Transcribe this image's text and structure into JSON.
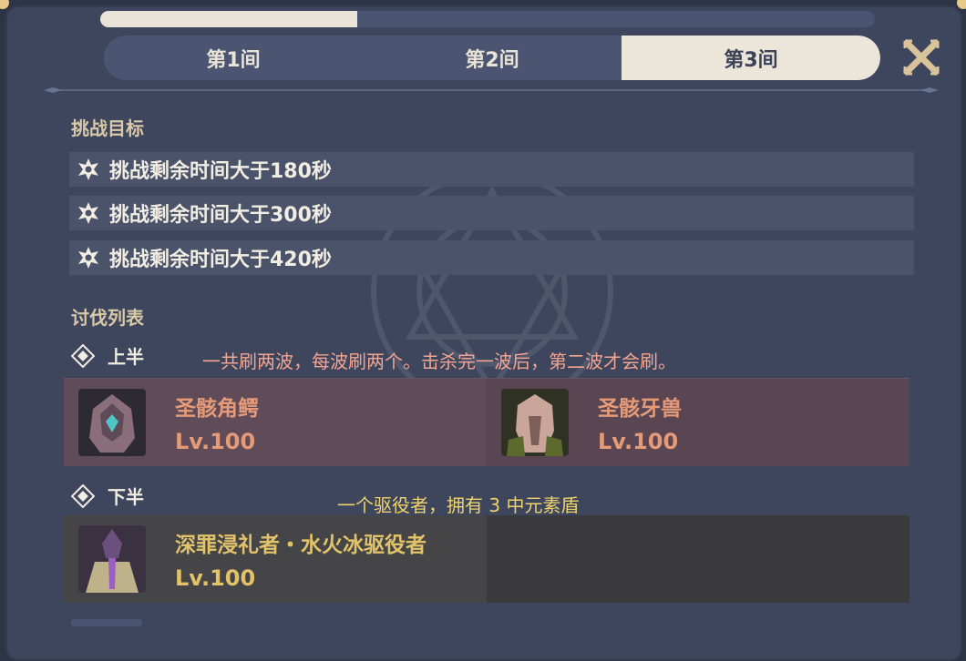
{
  "tabs": [
    {
      "label": "第1间",
      "active": false
    },
    {
      "label": "第2间",
      "active": false
    },
    {
      "label": "第3间",
      "active": true
    }
  ],
  "challenge": {
    "title": "挑战目标",
    "goals": [
      "挑战剩余时间大于180秒",
      "挑战剩余时间大于300秒",
      "挑战剩余时间大于420秒"
    ]
  },
  "enemy_list": {
    "title": "讨伐列表",
    "first_half": {
      "label": "上半",
      "annotation": "一共刷两波，每波刷两个。击杀完一波后，第二波才会刷。",
      "enemies": [
        {
          "name": "圣骸角鳄",
          "level": "Lv.100"
        },
        {
          "name": "圣骸牙兽",
          "level": "Lv.100"
        }
      ]
    },
    "second_half": {
      "label": "下半",
      "annotation": "一个驱役者，拥有 3 中元素盾",
      "enemies": [
        {
          "name": "深罪浸礼者・水火冰驱役者",
          "level": "Lv.100"
        }
      ]
    }
  },
  "colors": {
    "panel": "#3d465d",
    "tab_active": "#ece5da",
    "section_title": "#d9c9a8",
    "enemy_name_top": "#e59a78",
    "enemy_name_bottom": "#e2c36a",
    "annotation_top": "#f4a491",
    "annotation_bottom": "#f0d36a"
  },
  "icons": {
    "close": "close-x-icon",
    "goal": "star-icon",
    "half": "diamond-icon"
  }
}
